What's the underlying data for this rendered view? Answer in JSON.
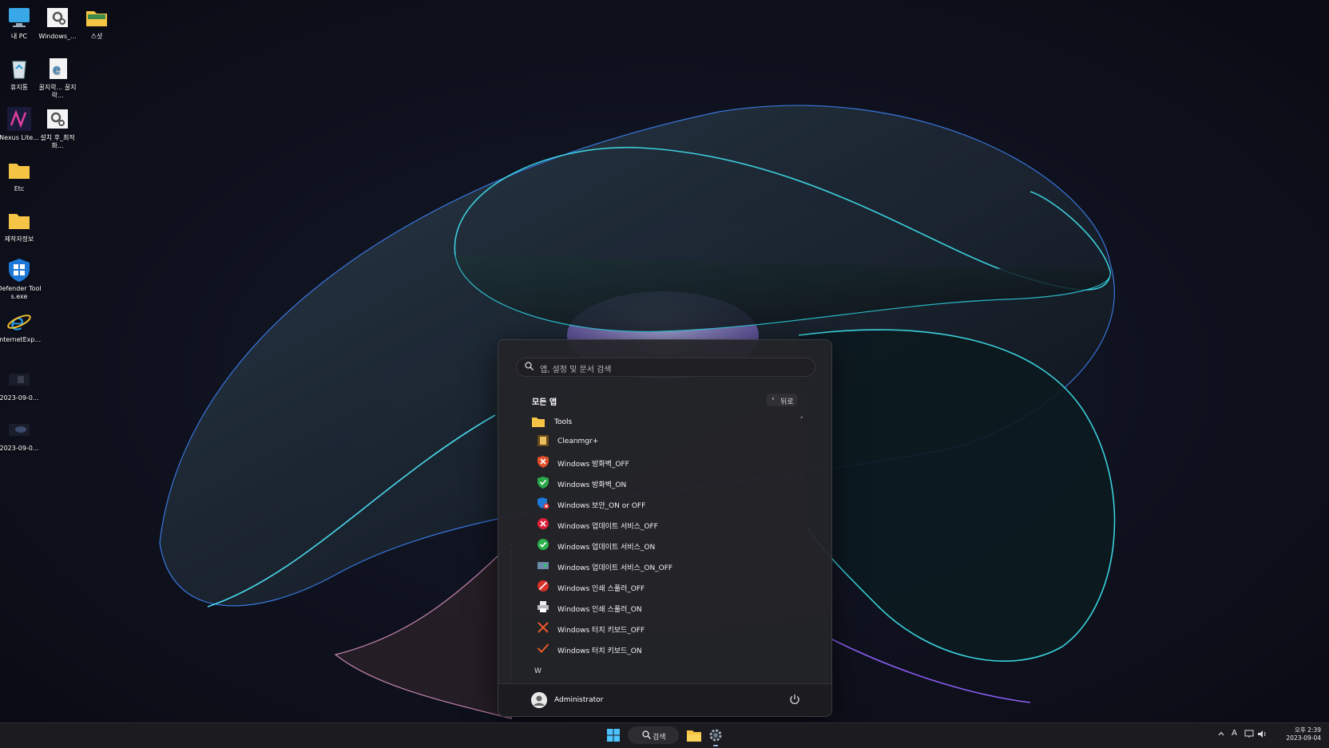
{
  "desktop": {
    "icons": [
      {
        "label": "내 PC",
        "icon": "monitor-icon"
      },
      {
        "label": "Windows_...",
        "icon": "settings-file-icon"
      },
      {
        "label": "스샷",
        "icon": "folder-icon"
      },
      {
        "label": "휴지통",
        "icon": "recycle-bin-icon"
      },
      {
        "label": "꿀지락... 꿀지락...",
        "icon": "ie-shortcut-icon"
      },
      {
        "label": "Nexus Lite...",
        "icon": "nexus-icon"
      },
      {
        "label": "설치 후_최적화...",
        "icon": "settings-file-icon"
      },
      {
        "label": "Etc",
        "icon": "folder-icon"
      },
      {
        "label": "제작자정보",
        "icon": "folder-icon"
      },
      {
        "label": "Defender Tools.exe",
        "icon": "shield-icon"
      },
      {
        "label": "InternetExp...",
        "icon": "ie-icon"
      },
      {
        "label": "2023-09-0...",
        "icon": "screenshot-thumb-icon"
      },
      {
        "label": "2023-09-0...",
        "icon": "screenshot-thumb-icon"
      }
    ]
  },
  "start_menu": {
    "search_placeholder": "앱, 설정 및 문서 검색",
    "all_apps_title": "모든 앱",
    "back_label": "뒤로",
    "folder": {
      "name": "Tools",
      "expanded": true
    },
    "apps": [
      {
        "label": "Cleanmgr+",
        "icon": "cleanmgr-icon"
      },
      {
        "label": "Windows 방화벽_OFF",
        "icon": "firewall-off-icon"
      },
      {
        "label": "Windows 방화벽_ON",
        "icon": "firewall-on-icon"
      },
      {
        "label": "Windows 보안_ON or OFF",
        "icon": "security-toggle-icon"
      },
      {
        "label": "Windows 업데이트 서비스_OFF",
        "icon": "red-x-circle-icon"
      },
      {
        "label": "Windows 업데이트 서비스_ON",
        "icon": "green-check-circle-icon"
      },
      {
        "label": "Windows 업데이트 서비스_ON_OFF",
        "icon": "service-toggle-icon"
      },
      {
        "label": "Windows 인쇄 스풀러_OFF",
        "icon": "print-off-icon"
      },
      {
        "label": "Windows 인쇄 스풀러_ON",
        "icon": "printer-icon"
      },
      {
        "label": "Windows 터치 키보드_OFF",
        "icon": "orange-x-icon"
      },
      {
        "label": "Windows 터치 키보드_ON",
        "icon": "orange-check-icon"
      }
    ],
    "section_letter": "W",
    "user_name": "Administrator"
  },
  "taskbar": {
    "search_label": "검색",
    "tray": {
      "ime": "A",
      "time": "오후 2:39",
      "date": "2023-09-04"
    }
  },
  "colors": {
    "accent": "#4cc2ff",
    "menu_bg": "#242428",
    "taskbar_bg": "#1c1c20"
  }
}
